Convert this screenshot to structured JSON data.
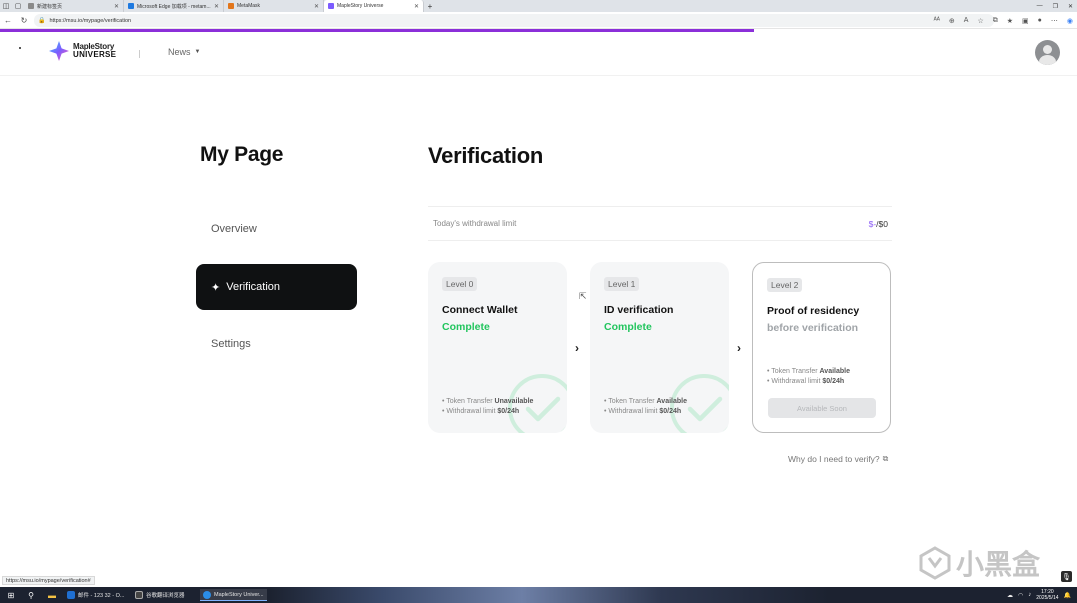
{
  "browser": {
    "tabs": [
      {
        "label": "新建标签页",
        "favicon_color": "#8a8a8a"
      },
      {
        "label": "Microsoft Edge 加载项 - metam...",
        "favicon_color": "#1f7ae0"
      },
      {
        "label": "MetaMask",
        "favicon_color": "#e2761b"
      },
      {
        "label": "MapleStory Universe",
        "favicon_color": "#7c5cff"
      }
    ],
    "new_tab": "+",
    "url": "https://msu.io/mypage/verification",
    "status_url": "https://msu.io/mypage/verification#",
    "progress_color": "#8b2fd9"
  },
  "header": {
    "logo_line1": "MapleStory",
    "logo_line2": "UNIVERSE",
    "nav_news": "News"
  },
  "sidebar": {
    "title": "My Page",
    "items": [
      {
        "label": "Overview"
      },
      {
        "label": "Verification"
      },
      {
        "label": "Settings"
      }
    ]
  },
  "main": {
    "title": "Verification",
    "limit_label": "Today's withdrawal limit",
    "limit_value_prefix": "$-",
    "limit_value_suffix": "/$0",
    "cards": [
      {
        "level": "Level 0",
        "title": "Connect Wallet",
        "status": "Complete",
        "note1_text": "• Token Transfer ",
        "note1_bold": "Unavailable",
        "note2_text": "• Withdrawal limit ",
        "note2_bold": "$0/24h"
      },
      {
        "level": "Level 1",
        "title": "ID verification",
        "status": "Complete",
        "note1_text": "• Token Transfer ",
        "note1_bold": "Available",
        "note2_text": "• Withdrawal limit ",
        "note2_bold": "$0/24h"
      },
      {
        "level": "Level 2",
        "title": "Proof of residency",
        "status": "before verification",
        "note1_text": "• Token Transfer ",
        "note1_bold": "Available",
        "note2_text": "• Withdrawal limit ",
        "note2_bold": "$0/24h",
        "button": "Available Soon"
      }
    ],
    "why_link": "Why do I need to verify?",
    "colors": {
      "complete": "#22c55e",
      "accent": "#8b5cf6"
    }
  },
  "taskbar": {
    "apps": [
      {
        "label": "邮件 - 123 32 - O...",
        "color": "#1f6fd1"
      },
      {
        "label": "谷歌翻译浏览器",
        "color": "#444"
      },
      {
        "label": "MapleStory Univer...",
        "color": "#2b8de6"
      }
    ],
    "time": "17:20",
    "date": "2025/5/14"
  },
  "watermark": "小黑盒"
}
